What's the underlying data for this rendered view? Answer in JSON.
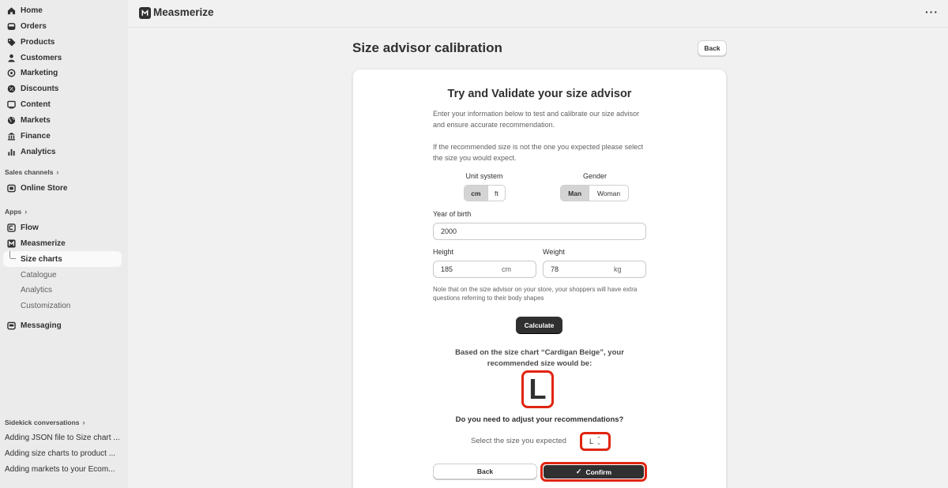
{
  "sidebar": {
    "items": [
      {
        "label": "Home",
        "icon": "home-icon"
      },
      {
        "label": "Orders",
        "icon": "orders-icon"
      },
      {
        "label": "Products",
        "icon": "tag-icon"
      },
      {
        "label": "Customers",
        "icon": "person-icon"
      },
      {
        "label": "Marketing",
        "icon": "target-icon"
      },
      {
        "label": "Discounts",
        "icon": "discount-icon"
      },
      {
        "label": "Content",
        "icon": "content-icon"
      },
      {
        "label": "Markets",
        "icon": "globe-icon"
      },
      {
        "label": "Finance",
        "icon": "bank-icon"
      },
      {
        "label": "Analytics",
        "icon": "bar-chart-icon"
      }
    ],
    "sales_channels_label": "Sales channels",
    "online_store_label": "Online Store",
    "apps_label": "Apps",
    "flow_label": "Flow",
    "measmerize_label": "Measmerize",
    "sub_items": [
      "Size charts",
      "Catalogue",
      "Analytics",
      "Customization"
    ],
    "messaging_label": "Messaging",
    "sidekick_label": "Sidekick conversations",
    "conversations": [
      "Adding JSON file to Size chart ...",
      "Adding size charts to product ...",
      "Adding markets to your Ecom..."
    ]
  },
  "topbar": {
    "app_title": "Measmerize",
    "logo_letter": "M",
    "more_label": "···"
  },
  "page": {
    "title": "Size advisor calibration",
    "back_label": "Back"
  },
  "card": {
    "title": "Try and Validate your size advisor",
    "intro": "Enter your information below to test and calibrate our size advisor and ensure accurate recommendation.",
    "instruction": "If the recommended size is not the one you expected please select the size you would expect.",
    "unit_system": {
      "label": "Unit system",
      "options": [
        "cm",
        "ft"
      ],
      "selected": "cm"
    },
    "gender": {
      "label": "Gender",
      "options": [
        "Man",
        "Woman"
      ],
      "selected": "Man"
    },
    "year_of_birth": {
      "label": "Year of birth",
      "value": "2000"
    },
    "height": {
      "label": "Height",
      "value": "185",
      "unit": "cm"
    },
    "weight": {
      "label": "Weight",
      "value": "78",
      "unit": "kg"
    },
    "note": "Note that on the size advisor on your store, your shoppers will have extra questions referring to their body shapes",
    "calculate_label": "Calculate",
    "result_text": "Based on the size chart “Cardigan Beige”, your recommended size would be:",
    "recommended_size": "L",
    "adjust_question": "Do you need to adjust your recommendations?",
    "expected_label": "Select the size you expected",
    "expected_value": "L",
    "back_label": "Back",
    "confirm_label": "Confirm"
  },
  "colors": {
    "highlight": "#e02410",
    "primary_button": "#303030",
    "sidebar_bg": "#ebebeb",
    "page_bg": "#f1f1f1"
  }
}
